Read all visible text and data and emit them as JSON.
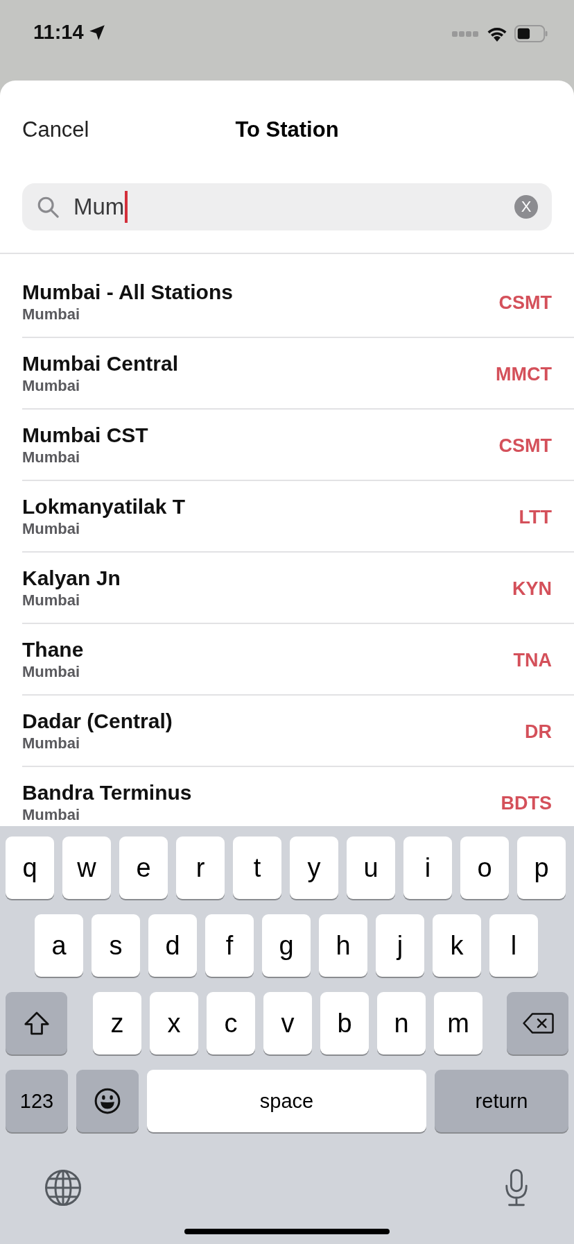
{
  "status_bar": {
    "time": "11:14"
  },
  "nav": {
    "cancel": "Cancel",
    "title": "To Station"
  },
  "search": {
    "value": "Mum",
    "clear": "X"
  },
  "stations": [
    {
      "name": "Mumbai - All Stations",
      "city": "Mumbai",
      "code": "CSMT"
    },
    {
      "name": "Mumbai Central",
      "city": "Mumbai",
      "code": "MMCT"
    },
    {
      "name": "Mumbai CST",
      "city": "Mumbai",
      "code": "CSMT"
    },
    {
      "name": "Lokmanyatilak T",
      "city": "Mumbai",
      "code": "LTT"
    },
    {
      "name": "Kalyan Jn",
      "city": "Mumbai",
      "code": "KYN"
    },
    {
      "name": "Thane",
      "city": "Mumbai",
      "code": "TNA"
    },
    {
      "name": "Dadar (Central)",
      "city": "Mumbai",
      "code": "DR"
    },
    {
      "name": "Bandra Terminus",
      "city": "Mumbai",
      "code": "BDTS"
    }
  ],
  "keyboard": {
    "top_row": [
      {
        "kind": "letter",
        "label": "q"
      },
      {
        "kind": "letter",
        "label": "w"
      },
      {
        "kind": "letter",
        "label": "e"
      },
      {
        "kind": "letter",
        "label": "r"
      },
      {
        "kind": "letter",
        "label": "t"
      },
      {
        "kind": "letter",
        "label": "y"
      },
      {
        "kind": "letter",
        "label": "u"
      },
      {
        "kind": "letter",
        "label": "i"
      },
      {
        "kind": "letter",
        "label": "o"
      },
      {
        "kind": "letter",
        "label": "p"
      }
    ],
    "middle_row": [
      {
        "kind": "letter",
        "label": "a"
      },
      {
        "kind": "letter",
        "label": "s"
      },
      {
        "kind": "letter",
        "label": "d"
      },
      {
        "kind": "letter",
        "label": "f"
      },
      {
        "kind": "letter",
        "label": "g"
      },
      {
        "kind": "letter",
        "label": "h"
      },
      {
        "kind": "letter",
        "label": "j"
      },
      {
        "kind": "letter",
        "label": "k"
      },
      {
        "kind": "letter",
        "label": "l"
      }
    ],
    "lower_row": [
      {
        "kind": "shift"
      },
      {
        "kind": "letter",
        "label": "z"
      },
      {
        "kind": "letter",
        "label": "x"
      },
      {
        "kind": "letter",
        "label": "c"
      },
      {
        "kind": "letter",
        "label": "v"
      },
      {
        "kind": "letter",
        "label": "b"
      },
      {
        "kind": "letter",
        "label": "n"
      },
      {
        "kind": "letter",
        "label": "m"
      },
      {
        "kind": "delete"
      }
    ],
    "bottom_row": [
      {
        "kind": "mode",
        "label": "123"
      },
      {
        "kind": "emoji"
      },
      {
        "kind": "space",
        "label": "space"
      },
      {
        "kind": "return",
        "label": "return"
      }
    ]
  }
}
